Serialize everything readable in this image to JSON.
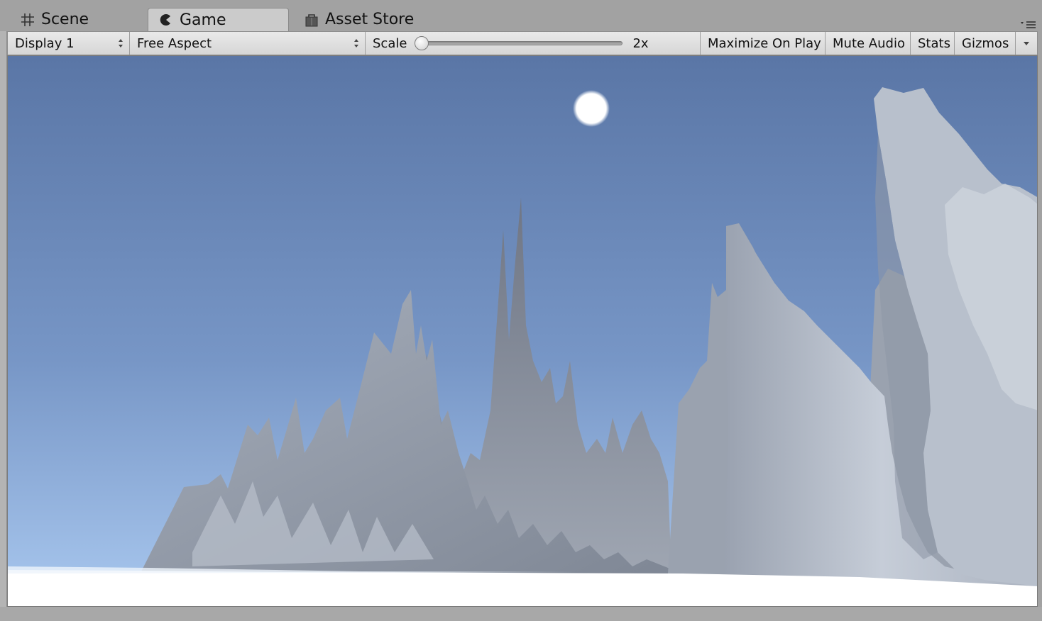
{
  "tabs": [
    {
      "label": "Scene",
      "icon": "grid-icon",
      "active": false
    },
    {
      "label": "Game",
      "icon": "game-icon",
      "active": true
    },
    {
      "label": "Asset Store",
      "icon": "store-bag-icon",
      "active": false
    }
  ],
  "toolbar": {
    "display": "Display 1",
    "aspect": "Free Aspect",
    "scale_label": "Scale",
    "scale_value": "2x",
    "scale_fraction": 0.0,
    "maximize_on_play": "Maximize On Play",
    "mute_audio": "Mute Audio",
    "stats": "Stats",
    "gizmos": "Gizmos"
  },
  "colors": {
    "sky_top": "#5a76a6",
    "sky_horizon": "#a9c8ef",
    "snow": "#ffffff",
    "rock_light": "#c3ccd8",
    "rock_dark": "#6d7481",
    "sun": "#ffffff"
  }
}
